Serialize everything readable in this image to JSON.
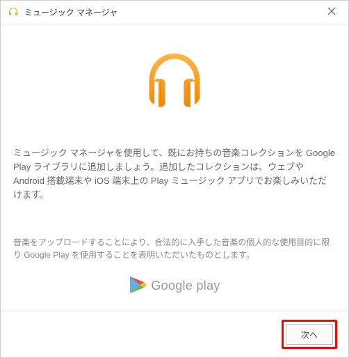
{
  "titlebar": {
    "title": "ミュージック マネージャ"
  },
  "main": {
    "description": "ミュージック マネージャを使用して、既にお持ちの音楽コレクションを Google Play ライブラリに追加しましょう。追加したコレクションは、ウェブや Android 搭載端末や iOS 端末上の Play ミュージック アプリでお楽しみいただけます。",
    "legal": "音楽をアップロードすることにより、合法的に入手した音楽の個人的な使用目的に限り Google Play を使用することを表明いただいたものとします。"
  },
  "brand": {
    "label": "Google play"
  },
  "footer": {
    "next_label": "次へ"
  },
  "icons": {
    "app": "music-manager-icon",
    "close": "close-icon",
    "hero": "headphones-icon",
    "play": "google-play-icon"
  },
  "colors": {
    "accent_orange": "#f5a623",
    "accent_orange_dark": "#e08b0b",
    "highlight_red": "#ff0000"
  }
}
